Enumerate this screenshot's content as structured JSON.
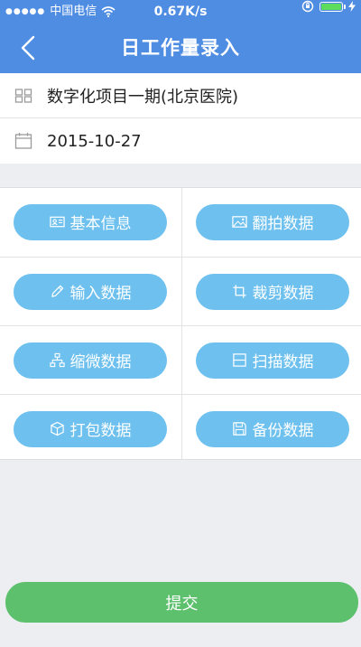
{
  "status_bar": {
    "signal": "●●●●●",
    "carrier": "中国电信",
    "speed": "0.67K/s"
  },
  "header": {
    "title": "日工作量录入"
  },
  "project": {
    "name": "数字化项目一期(北京医院)"
  },
  "date": {
    "value": "2015-10-27"
  },
  "actions": [
    {
      "label": "基本信息",
      "icon": "id-card-icon"
    },
    {
      "label": "翻拍数据",
      "icon": "image-icon"
    },
    {
      "label": "输入数据",
      "icon": "pencil-icon"
    },
    {
      "label": "裁剪数据",
      "icon": "crop-icon"
    },
    {
      "label": "缩微数据",
      "icon": "hierarchy-icon"
    },
    {
      "label": "扫描数据",
      "icon": "scanner-icon"
    },
    {
      "label": "打包数据",
      "icon": "box-icon"
    },
    {
      "label": "备份数据",
      "icon": "floppy-disk-icon"
    }
  ],
  "footer": {
    "submit_label": "提交"
  },
  "colors": {
    "header_bg": "#4f8de3",
    "pill_bg": "#6ec0ee",
    "submit_bg": "#5dc06d",
    "page_bg": "#eceef2"
  }
}
